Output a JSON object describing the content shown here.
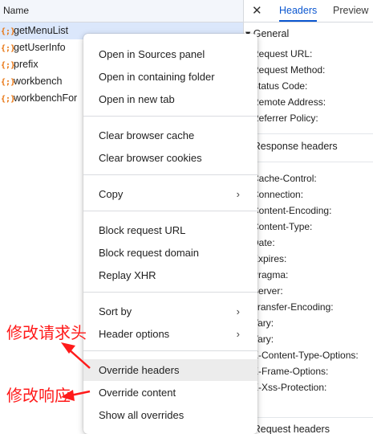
{
  "list": {
    "header": "Name",
    "rows": [
      {
        "name": "getMenuList",
        "selected": true
      },
      {
        "name": "getUserInfo",
        "selected": false
      },
      {
        "name": "prefix",
        "selected": false
      },
      {
        "name": "workbench",
        "selected": false
      },
      {
        "name": "workbenchFor",
        "selected": false
      }
    ],
    "row_icon": "{;}"
  },
  "detail": {
    "close": "✕",
    "tabs": [
      "Headers",
      "Preview"
    ],
    "active_tab": "Headers",
    "general": {
      "title": "▾ General",
      "lines": [
        "Request URL:",
        "Request Method:",
        "Status Code:",
        "Remote Address:",
        "Referrer Policy:"
      ]
    },
    "response": {
      "title": "▸ Response headers",
      "lines": [
        "Cache-Control:",
        "Connection:",
        "Content-Encoding:",
        "Content-Type:",
        "Date:",
        "Expires:",
        "Pragma:",
        "Server:",
        "Transfer-Encoding:",
        "Vary:",
        "Vary:",
        "X-Content-Type-Options:",
        "X-Frame-Options:",
        "X-Xss-Protection:"
      ]
    },
    "request": {
      "title": "▸ Request headers"
    }
  },
  "menu": {
    "items": [
      {
        "label": "Open in Sources panel"
      },
      {
        "label": "Open in containing folder"
      },
      {
        "label": "Open in new tab"
      },
      {
        "label": "Clear browser cache"
      },
      {
        "label": "Clear browser cookies"
      },
      {
        "label": "Copy",
        "submenu": true
      },
      {
        "label": "Block request URL"
      },
      {
        "label": "Block request domain"
      },
      {
        "label": "Replay XHR"
      },
      {
        "label": "Sort by",
        "submenu": true
      },
      {
        "label": "Header options",
        "submenu": true
      },
      {
        "label": "Override headers",
        "hovered": true
      },
      {
        "label": "Override content"
      },
      {
        "label": "Show all overrides"
      }
    ],
    "chevron": "›"
  },
  "annotations": {
    "modify_request_headers": "修改请求头",
    "modify_response": "修改响应",
    "color": "#ff1a1a"
  },
  "colors": {
    "accent": "#0b57d0",
    "selected_row": "#dbe7fb",
    "icon": "#e8710a"
  }
}
